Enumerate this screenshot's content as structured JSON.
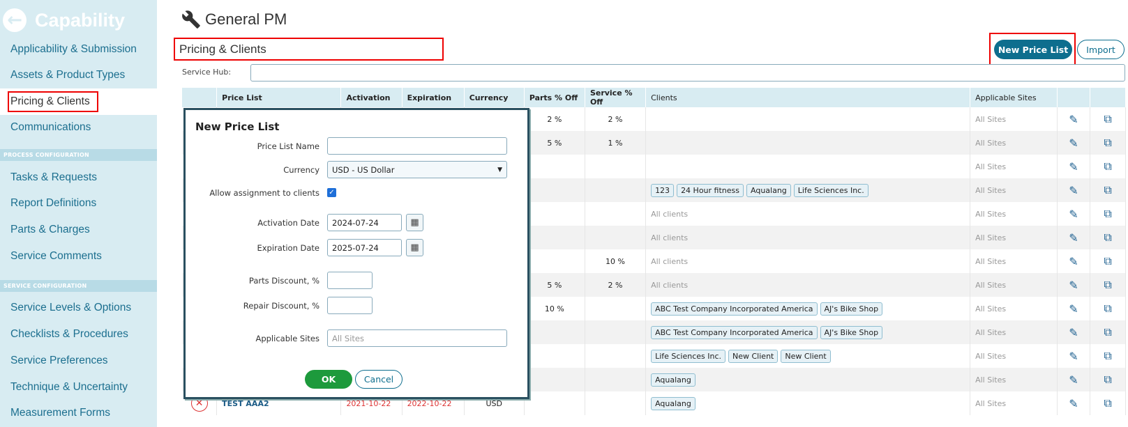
{
  "app": {
    "back_icon": "arrow-left-icon",
    "title": "Capability"
  },
  "sidebar": {
    "items": [
      {
        "label": "Applicability & Submission"
      },
      {
        "label": "Assets & Product Types"
      },
      {
        "label": "Pricing & Clients",
        "active": true
      },
      {
        "label": "Communications"
      },
      {
        "label": "Tasks & Requests"
      },
      {
        "label": "Report Definitions"
      },
      {
        "label": "Parts & Charges"
      },
      {
        "label": "Service Comments"
      },
      {
        "label": "Service Levels & Options"
      },
      {
        "label": "Checklists & Procedures"
      },
      {
        "label": "Service Preferences"
      },
      {
        "label": "Technique & Uncertainty"
      },
      {
        "label": "Measurement Forms"
      }
    ],
    "section_headers": [
      "PROCESS CONFIGURATION",
      "SERVICE CONFIGURATION"
    ]
  },
  "header": {
    "icon": "wrench-icon",
    "title": "General PM",
    "section": "Pricing & Clients"
  },
  "toolbar": {
    "new_price_list": "New Price List",
    "import": "Import"
  },
  "service_hub": {
    "label": "Service Hub:",
    "value": ""
  },
  "table": {
    "columns": [
      "",
      "Price List",
      "Activation",
      "Expiration",
      "Currency",
      "Parts % Off",
      "Service % Off",
      "Clients",
      "Applicable Sites",
      "",
      ""
    ],
    "rows": [
      {
        "parts": "2 %",
        "service": "2 %",
        "clients": [],
        "clients_text": "",
        "sites": "All Sites"
      },
      {
        "parts": "5 %",
        "service": "1 %",
        "clients": [],
        "clients_text": "",
        "sites": "All Sites"
      },
      {
        "parts": "",
        "service": "",
        "clients": [],
        "clients_text": "",
        "sites": "All Sites"
      },
      {
        "parts": "",
        "service": "",
        "clients": [
          "123",
          "24 Hour fitness",
          "Aqualang",
          "Life Sciences Inc."
        ],
        "clients_text": "",
        "sites": "All Sites"
      },
      {
        "parts": "",
        "service": "",
        "clients": [],
        "clients_text": "All clients",
        "sites": "All Sites"
      },
      {
        "parts": "",
        "service": "",
        "clients": [],
        "clients_text": "All clients",
        "sites": "All Sites"
      },
      {
        "parts": "",
        "service": "10 %",
        "clients": [],
        "clients_text": "All clients",
        "sites": "All Sites"
      },
      {
        "parts": "5 %",
        "service": "2 %",
        "clients": [],
        "clients_text": "All clients",
        "sites": "All Sites"
      },
      {
        "parts": "10 %",
        "service": "",
        "clients": [
          "ABC Test Company Incorporated America",
          "AJ's Bike Shop"
        ],
        "clients_text": "",
        "sites": "All Sites"
      },
      {
        "parts": "",
        "service": "",
        "clients": [
          "ABC Test Company Incorporated America",
          "AJ's Bike Shop"
        ],
        "clients_text": "",
        "sites": "All Sites"
      },
      {
        "parts": "",
        "service": "",
        "clients": [
          "Life Sciences Inc.",
          "New Client",
          "New Client"
        ],
        "clients_text": "",
        "sites": "All Sites"
      },
      {
        "parts": "",
        "service": "",
        "clients": [
          "Aqualang"
        ],
        "clients_text": "",
        "sites": "All Sites"
      },
      {
        "name": "TEST AAA2",
        "activation": "2021-10-22",
        "expiration": "2022-10-22",
        "currency": "USD",
        "parts": "",
        "service": "",
        "clients": [
          "Aqualang"
        ],
        "clients_text": "",
        "sites": "All Sites"
      }
    ]
  },
  "dialog": {
    "title": "New Price List",
    "price_list_name_label": "Price List Name",
    "price_list_name_value": "",
    "currency_label": "Currency",
    "currency_value": "USD - US Dollar",
    "allow_label": "Allow assignment to clients",
    "allow_checked": true,
    "activation_label": "Activation Date",
    "activation_value": "2024-07-24",
    "expiration_label": "Expiration Date",
    "expiration_value": "2025-07-24",
    "parts_discount_label": "Parts Discount, %",
    "parts_discount_value": "",
    "repair_discount_label": "Repair Discount, %",
    "repair_discount_value": "",
    "sites_label": "Applicable Sites",
    "sites_placeholder": "All Sites",
    "ok": "OK",
    "cancel": "Cancel"
  },
  "colors": {
    "sidebar_bg": "#d8ecf2",
    "accent": "#0e6e8e",
    "ok_green": "#1d9a3c",
    "danger": "#d33",
    "highlight_frame": "#e00"
  }
}
